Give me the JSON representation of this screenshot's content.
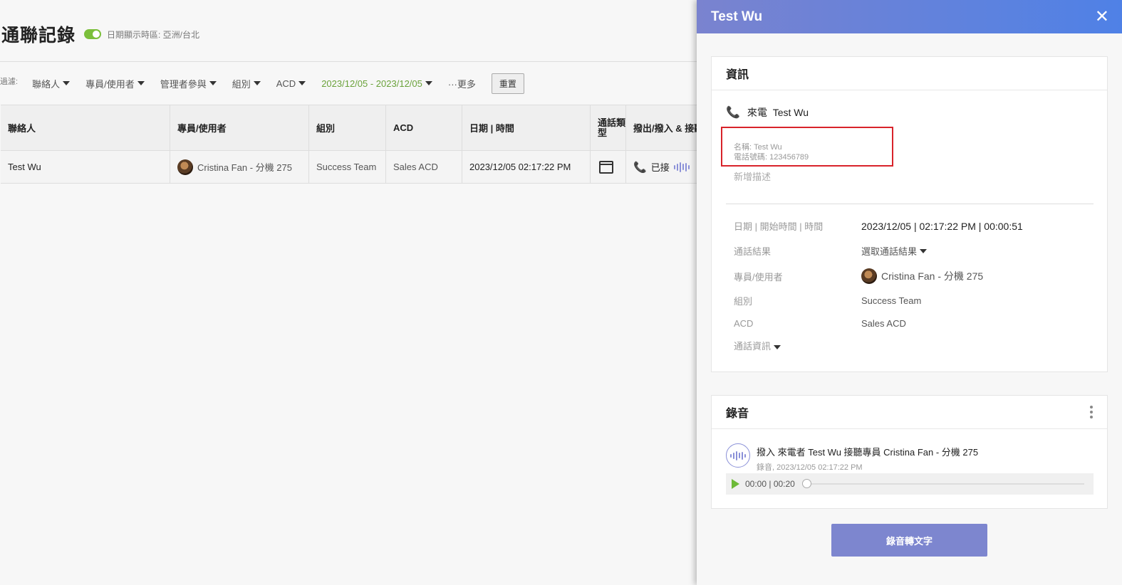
{
  "header": {
    "title": "通聯記錄",
    "timezone_label": "日期顯示時區: 亞洲/台北"
  },
  "filters": {
    "prefix": "過濾:",
    "items": [
      "聯絡人",
      "專員/使用者",
      "管理者參與",
      "組別",
      "ACD"
    ],
    "date_range": "2023/12/05 - 2023/12/05",
    "more": "···更多",
    "reset": "重置"
  },
  "table": {
    "headers": [
      "聯絡人",
      "專員/使用者",
      "組別",
      "ACD",
      "日期 | 時間",
      "通話類型",
      "撥出/撥入 & 接聽"
    ],
    "rows": [
      {
        "contact": "Test Wu",
        "agent": "Cristina Fan - 分機 275",
        "group": "Success Team",
        "acd": "Sales ACD",
        "datetime": "2023/12/05 02:17:22 PM",
        "status": "已接"
      }
    ]
  },
  "panel": {
    "title": "Test Wu",
    "info": {
      "title": "資訊",
      "caller_line": "來電  Test Wu",
      "contact_name": "名稱: Test Wu",
      "contact_phone": "電話號碼: 123456789",
      "add_description": "新增描述",
      "rows": [
        {
          "key": "日期 | 開始時間 | 時間",
          "value": "2023/12/05 | 02:17:22 PM | 00:00:51"
        },
        {
          "key": "通話結果",
          "value": "選取通話結果"
        },
        {
          "key": "專員/使用者",
          "value": "Cristina Fan - 分機 275"
        },
        {
          "key": "組別",
          "value": "Success Team"
        },
        {
          "key": "ACD",
          "value": "Sales ACD"
        }
      ],
      "call_info": "通話資訊"
    },
    "recording": {
      "title": "錄音",
      "item_title": "撥入 來電者 Test Wu 接聽專員 Cristina Fan - 分機 275",
      "item_sub": "錄音, 2023/12/05 02:17:22 PM",
      "time": "00:00 | 00:20"
    },
    "transcribe_button": "錄音轉文字"
  }
}
